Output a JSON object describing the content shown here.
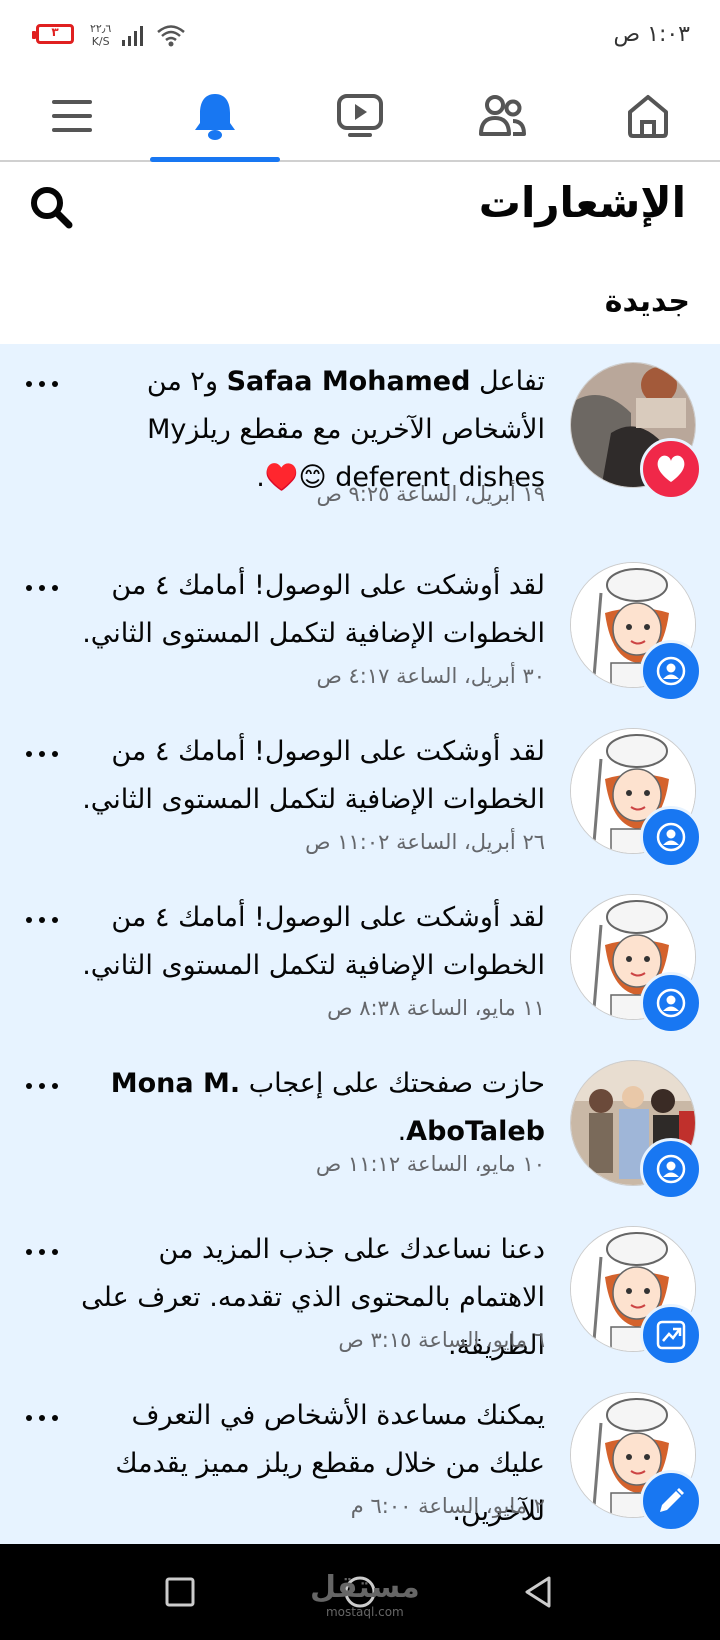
{
  "status": {
    "time": "١:٠٣ ص",
    "battery": "٣",
    "net_speed_top": "٢٢٫٦",
    "net_speed_bottom": "K/S"
  },
  "nav": {
    "tabs": [
      "home-icon",
      "friends-icon",
      "video-icon",
      "bell-icon",
      "menu-icon"
    ],
    "active": "bell-icon"
  },
  "header": {
    "title": "الإشعارات",
    "section": "جديدة"
  },
  "notifications": [
    {
      "prefix": "تفاعل ",
      "name": "Safaa Mohamed",
      "rest": " و٢ من الأشخاص الآخرين مع مقطع ريلزMy deferent dishes 😊♥️.",
      "time": "١٩ أبريل، الساعة ٩:٢٥ ص",
      "badge": "heart-icon"
    },
    {
      "text": "لقد أوشكت على الوصول! أمامك ٤ من الخطوات الإضافية لتكمل المستوى الثاني.",
      "time": "٣٠ أبريل، الساعة ٤:١٧ ص",
      "badge": "person-icon"
    },
    {
      "text": "لقد أوشكت على الوصول! أمامك ٤ من الخطوات الإضافية لتكمل المستوى الثاني.",
      "time": "٢٦ أبريل، الساعة ١١:٠٢ ص",
      "badge": "person-icon"
    },
    {
      "text": "لقد أوشكت على الوصول! أمامك ٤ من الخطوات الإضافية لتكمل المستوى الثاني.",
      "time": "١١ مايو، الساعة ٨:٣٨ ص",
      "badge": "person-icon"
    },
    {
      "prefix": "حازت صفحتك على إعجاب ",
      "name": "Mona M. AboTaleb",
      "rest": ".",
      "time": "١٠ مايو، الساعة ١١:١٢ ص",
      "badge": "person-icon"
    },
    {
      "text": "دعنا نساعدك على جذب المزيد من الاهتمام بالمحتوى الذي تقدمه. تعرف على الطريقة.",
      "time": "٦ مايو، الساعة ٣:١٥ ص",
      "badge": "trend-icon"
    },
    {
      "text": "يمكنك مساعدة الأشخاص في التعرف عليك من خلال مقطع ريلز مميز يقدمك للآخرين.",
      "time": "٢ مايو، الساعة ٦:٠٠ م",
      "badge": "pencil-icon"
    }
  ],
  "watermark": {
    "main": "مستقل",
    "sub": "mostaql.com"
  },
  "colors": {
    "accent": "#1877f2",
    "list_bg": "#e7f3ff",
    "heart": "#f02849"
  }
}
